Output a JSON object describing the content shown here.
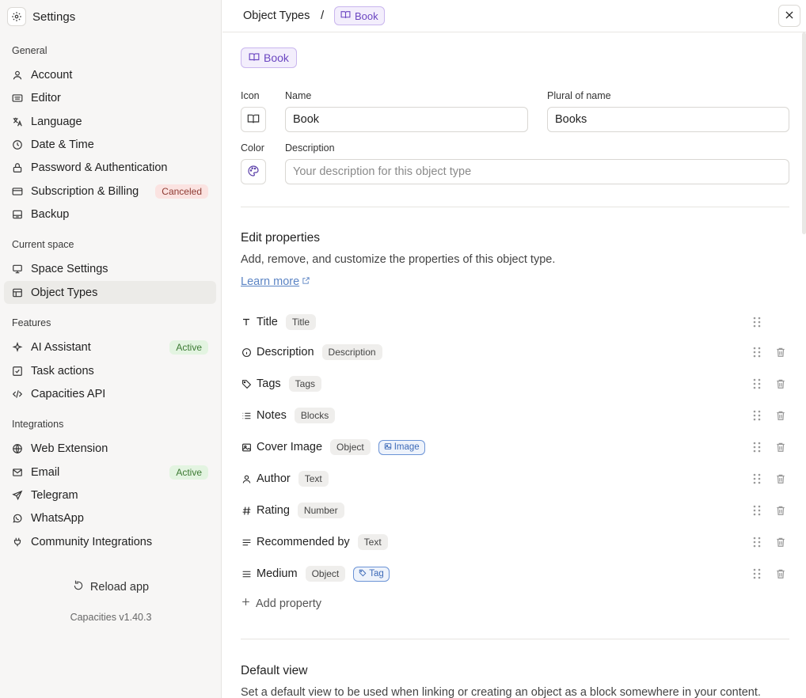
{
  "sidebar": {
    "title": "Settings",
    "sections": {
      "general": "General",
      "current_space": "Current space",
      "features": "Features",
      "integrations": "Integrations"
    },
    "items": {
      "account": "Account",
      "editor": "Editor",
      "language": "Language",
      "datetime": "Date & Time",
      "password": "Password & Authentication",
      "subscription": "Subscription & Billing",
      "subscription_badge": "Canceled",
      "backup": "Backup",
      "space_settings": "Space Settings",
      "object_types": "Object Types",
      "ai_assistant": "AI Assistant",
      "ai_badge": "Active",
      "task_actions": "Task actions",
      "capacities_api": "Capacities API",
      "web_extension": "Web Extension",
      "email": "Email",
      "email_badge": "Active",
      "telegram": "Telegram",
      "whatsapp": "WhatsApp",
      "community": "Community Integrations"
    },
    "reload": "Reload app",
    "version": "Capacities v1.40.3"
  },
  "topbar": {
    "crumb": "Object Types",
    "sep": "/",
    "chip": "Book"
  },
  "form": {
    "chip": "Book",
    "icon_label": "Icon",
    "name_label": "Name",
    "name_value": "Book",
    "plural_label": "Plural of name",
    "plural_value": "Books",
    "color_label": "Color",
    "description_label": "Description",
    "description_placeholder": "Your description for this object type"
  },
  "properties": {
    "heading": "Edit properties",
    "desc": "Add, remove, and customize the properties of this object type.",
    "learn_more": "Learn more",
    "items": [
      {
        "name": "Title",
        "type": "Title"
      },
      {
        "name": "Description",
        "type": "Description"
      },
      {
        "name": "Tags",
        "type": "Tags"
      },
      {
        "name": "Notes",
        "type": "Blocks"
      },
      {
        "name": "Cover Image",
        "type": "Object",
        "link": "Image"
      },
      {
        "name": "Author",
        "type": "Text"
      },
      {
        "name": "Rating",
        "type": "Number"
      },
      {
        "name": "Recommended by",
        "type": "Text"
      },
      {
        "name": "Medium",
        "type": "Object",
        "link": "Tag"
      }
    ],
    "add": "Add property"
  },
  "default_view": {
    "heading": "Default view",
    "desc": "Set a default view to be used when linking or creating an object as a block somewhere in your content."
  },
  "colors": {
    "accent": "#6b46c1",
    "link": "#5b84c4",
    "badge_red": "#fbe3e1",
    "badge_green": "#e3f4e1"
  }
}
